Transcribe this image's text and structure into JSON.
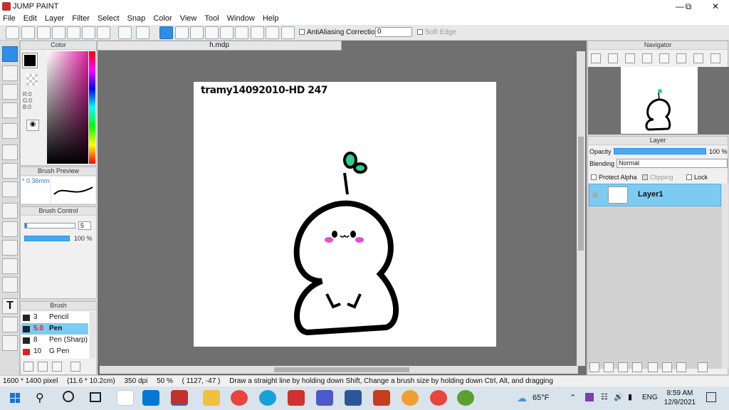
{
  "window": {
    "title": "JUMP PAINT"
  },
  "menu": [
    "File",
    "Edit",
    "Layer",
    "Filter",
    "Select",
    "Snap",
    "Color",
    "View",
    "Tool",
    "Window",
    "Help"
  ],
  "toolbar": {
    "antialiasing_label": "AntiAliasing",
    "correction_label": "Correction",
    "correction_value": "0",
    "soft_edge_label": "Soft Edge"
  },
  "panels": {
    "color": {
      "title": "Color",
      "r": "R:0",
      "g": "G:0",
      "b": "B:0",
      "fg_color": "#000000"
    },
    "brush_preview": {
      "title": "Brush Preview",
      "size": "* 0.36mm"
    },
    "brush_control": {
      "title": "Brush Control",
      "size": "5",
      "opacity": "100 %"
    },
    "brush": {
      "title": "Brush",
      "items": [
        {
          "size": "3",
          "name": "Pencil",
          "color": "#222222"
        },
        {
          "size": "5.0",
          "name": "Pen",
          "color": "#222222",
          "selected": true
        },
        {
          "size": "8",
          "name": "Pen (Sharp)",
          "color": "#222222"
        },
        {
          "size": "10",
          "name": "G Pen",
          "color": "#e02020"
        }
      ]
    },
    "navigator": {
      "title": "Navigator"
    },
    "layer": {
      "title": "Layer",
      "opacity_label": "Opacity",
      "opacity_value": "100 %",
      "blending_label": "Blending",
      "blending_value": "Normal",
      "protect_alpha": "Protect Alpha",
      "clipping": "Clipping",
      "lock": "Lock",
      "layers": [
        {
          "name": "Layer1"
        }
      ]
    }
  },
  "document": {
    "tab": "h.mdp",
    "signature": "tramy14092010-HD 247"
  },
  "status": {
    "size": "1600 * 1400 pixel",
    "cm": "(11.6 * 10.2cm)",
    "dpi": "350 dpi",
    "zoom": "50 %",
    "coords": "( 1127, -47 )",
    "hint": "Draw a straight line by holding down Shift, Change a brush size by holding down Ctrl, Alt, and dragging"
  },
  "taskbar": {
    "weather": "65°F",
    "lang": "ENG",
    "time": "8:59 AM",
    "date": "12/9/2021"
  },
  "colors": {
    "accent": "#2e8ee6",
    "selected_row": "#7ccbf2",
    "layer_selected": "#7ccbf2"
  }
}
